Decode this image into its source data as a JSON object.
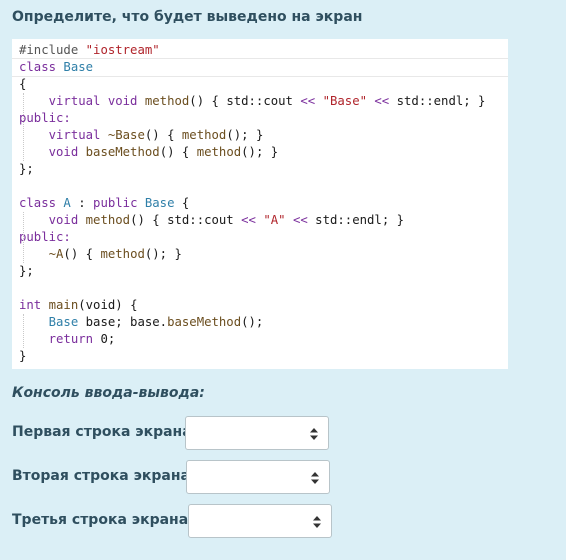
{
  "question": {
    "title": "Определите, что будет выведено на экран"
  },
  "code": {
    "lines": [
      [
        {
          "t": "#include ",
          "c": "pp"
        },
        {
          "t": "\"iostream\"",
          "c": "st"
        }
      ],
      [
        {
          "t": "class ",
          "c": "kw"
        },
        {
          "t": "Base",
          "c": "ty"
        }
      ],
      [
        {
          "t": "{",
          "c": "nm"
        }
      ],
      [
        {
          "t": "    virtual ",
          "c": "kw"
        },
        {
          "t": "void ",
          "c": "kw"
        },
        {
          "t": "method",
          "c": "fn"
        },
        {
          "t": "() { std::cout ",
          "c": "nm"
        },
        {
          "t": "<<",
          "c": "kw"
        },
        {
          "t": " ",
          "c": "nm"
        },
        {
          "t": "\"Base\"",
          "c": "st"
        },
        {
          "t": " ",
          "c": "nm"
        },
        {
          "t": "<<",
          "c": "kw"
        },
        {
          "t": " std::endl; }",
          "c": "nm"
        }
      ],
      [
        {
          "t": "public:",
          "c": "kw"
        }
      ],
      [
        {
          "t": "    virtual ",
          "c": "kw"
        },
        {
          "t": "~Base",
          "c": "fn"
        },
        {
          "t": "() { ",
          "c": "nm"
        },
        {
          "t": "method",
          "c": "fn"
        },
        {
          "t": "(); }",
          "c": "nm"
        }
      ],
      [
        {
          "t": "    void ",
          "c": "kw"
        },
        {
          "t": "baseMethod",
          "c": "fn"
        },
        {
          "t": "() { ",
          "c": "nm"
        },
        {
          "t": "method",
          "c": "fn"
        },
        {
          "t": "(); }",
          "c": "nm"
        }
      ],
      [
        {
          "t": "};",
          "c": "nm"
        }
      ],
      [
        {
          "t": "",
          "c": "nm"
        }
      ],
      [
        {
          "t": "class ",
          "c": "kw"
        },
        {
          "t": "A",
          "c": "ty"
        },
        {
          "t": " : ",
          "c": "nm"
        },
        {
          "t": "public ",
          "c": "kw"
        },
        {
          "t": "Base",
          "c": "ty"
        },
        {
          "t": " {",
          "c": "nm"
        }
      ],
      [
        {
          "t": "    void ",
          "c": "kw"
        },
        {
          "t": "method",
          "c": "fn"
        },
        {
          "t": "() { std::cout ",
          "c": "nm"
        },
        {
          "t": "<<",
          "c": "kw"
        },
        {
          "t": " ",
          "c": "nm"
        },
        {
          "t": "\"A\"",
          "c": "st"
        },
        {
          "t": " ",
          "c": "nm"
        },
        {
          "t": "<<",
          "c": "kw"
        },
        {
          "t": " std::endl; }",
          "c": "nm"
        }
      ],
      [
        {
          "t": "public:",
          "c": "kw"
        }
      ],
      [
        {
          "t": "    ~A",
          "c": "fn"
        },
        {
          "t": "() { ",
          "c": "nm"
        },
        {
          "t": "method",
          "c": "fn"
        },
        {
          "t": "(); }",
          "c": "nm"
        }
      ],
      [
        {
          "t": "};",
          "c": "nm"
        }
      ],
      [
        {
          "t": "",
          "c": "nm"
        }
      ],
      [
        {
          "t": "int ",
          "c": "kw"
        },
        {
          "t": "main",
          "c": "fn"
        },
        {
          "t": "(void) {",
          "c": "nm"
        }
      ],
      [
        {
          "t": "    Base",
          "c": "ty"
        },
        {
          "t": " base; base.",
          "c": "nm"
        },
        {
          "t": "baseMethod",
          "c": "fn"
        },
        {
          "t": "();",
          "c": "nm"
        }
      ],
      [
        {
          "t": "    return ",
          "c": "kw"
        },
        {
          "t": "0;",
          "c": "nm"
        }
      ],
      [
        {
          "t": "}",
          "c": "nm"
        }
      ]
    ]
  },
  "console": {
    "title": "Консоль ввода-вывода:",
    "rows": [
      {
        "label": "Первая строка экрана:",
        "value": ""
      },
      {
        "label": "Вторая строка экрана:",
        "value": ""
      },
      {
        "label": "Третья строка экрана:",
        "value": ""
      }
    ]
  },
  "colors": {
    "background": "#dbeff6",
    "heading": "#2f4f5f",
    "keyword": "#7a2e9c",
    "type": "#2f7fa8",
    "string": "#b0242b",
    "function": "#6b4e1f"
  },
  "icons": {
    "select_arrow": "sort-updown-icon"
  }
}
